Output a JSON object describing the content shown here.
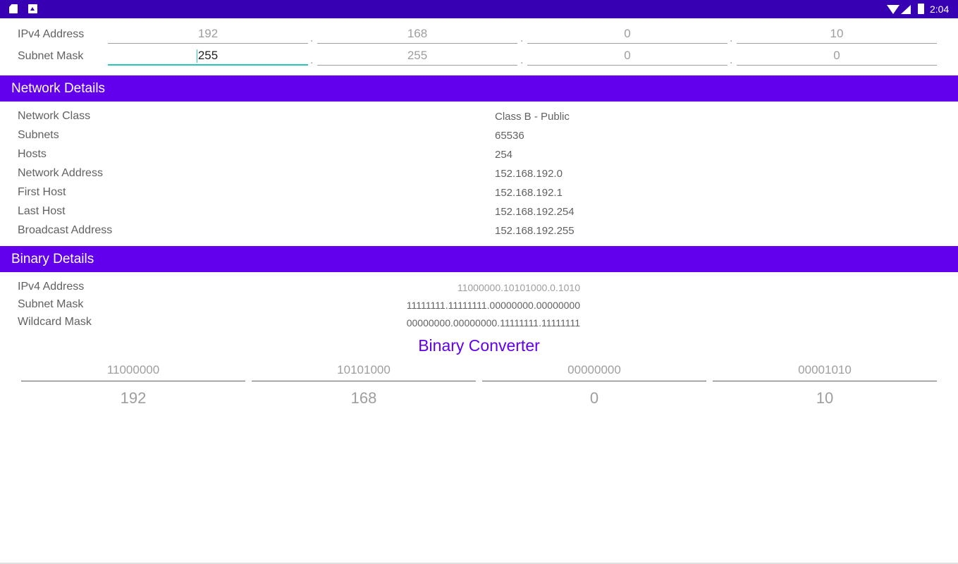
{
  "status_bar": {
    "time": "2:04",
    "icons": [
      "sd-card-icon",
      "image-icon",
      "wifi-icon",
      "cell-signal-icon",
      "battery-icon"
    ]
  },
  "colors": {
    "status_bar": "#3700b3",
    "section_header": "#6200ee",
    "accent": "#26c6b9",
    "converter_title": "#6200ee"
  },
  "inputs": {
    "ipv4": {
      "label": "IPv4 Address",
      "octets": [
        "192",
        "168",
        "0",
        "10"
      ]
    },
    "subnet": {
      "label": "Subnet Mask",
      "octets": [
        "255",
        "255",
        "0",
        "0"
      ]
    },
    "separator": "."
  },
  "network_details": {
    "title": "Network Details",
    "rows": [
      {
        "label": "Network Class",
        "value": "Class B - Public"
      },
      {
        "label": "Subnets",
        "value": "65536"
      },
      {
        "label": "Hosts",
        "value": "254"
      },
      {
        "label": "Network Address",
        "value": "152.168.192.0"
      },
      {
        "label": "First Host",
        "value": "152.168.192.1"
      },
      {
        "label": "Last Host",
        "value": "152.168.192.254"
      },
      {
        "label": "Broadcast Address",
        "value": "152.168.192.255"
      }
    ]
  },
  "binary_details": {
    "title": "Binary Details",
    "rows": [
      {
        "label": "IPv4 Address",
        "value": "11000000.10101000.0.1010"
      },
      {
        "label": "Subnet Mask",
        "value": "11111111.11111111.00000000.00000000"
      },
      {
        "label": "Wildcard Mask",
        "value": "00000000.00000000.11111111.11111111"
      }
    ]
  },
  "binary_converter": {
    "title": "Binary Converter",
    "binary": [
      "11000000",
      "10101000",
      "00000000",
      "00001010"
    ],
    "decimal": [
      "192",
      "168",
      "0",
      "10"
    ]
  }
}
